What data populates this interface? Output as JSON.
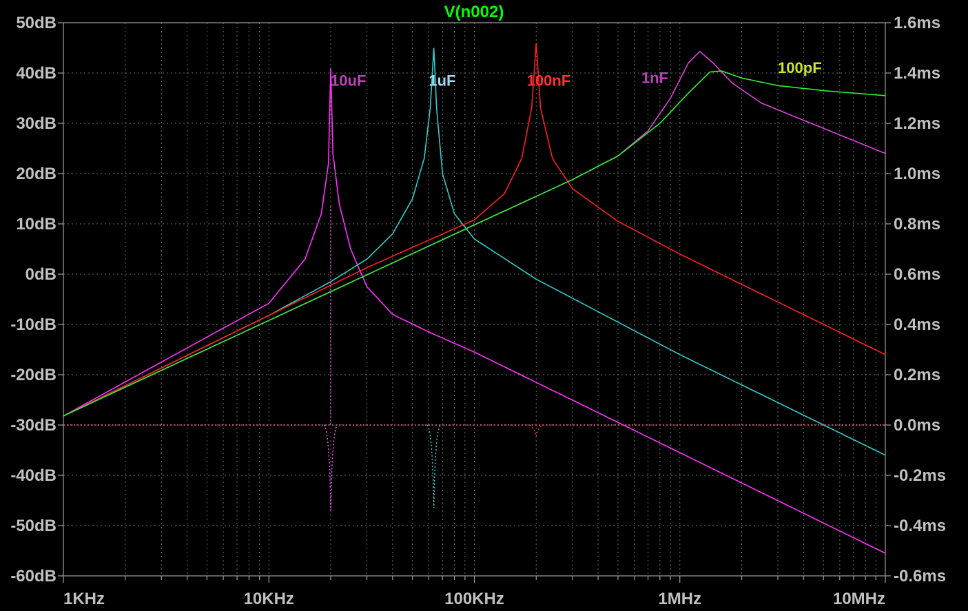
{
  "chart_data": {
    "type": "line",
    "title": "V(n002)",
    "title_color": "#00ff00",
    "x_scale": "log",
    "xlim": [
      1000,
      10000000
    ],
    "x_ticks": [
      {
        "value": 1000,
        "label": "1KHz"
      },
      {
        "value": 10000,
        "label": "10KHz"
      },
      {
        "value": 100000,
        "label": "100KHz"
      },
      {
        "value": 1000000,
        "label": "1MHz"
      },
      {
        "value": 10000000,
        "label": "10MHz"
      }
    ],
    "ylim_left": [
      -60,
      50
    ],
    "left_ticks": [
      "50dB",
      "40dB",
      "30dB",
      "20dB",
      "10dB",
      "0dB",
      "-10dB",
      "-20dB",
      "-30dB",
      "-40dB",
      "-50dB",
      "-60dB"
    ],
    "ylim_right": [
      -0.6,
      1.6
    ],
    "right_ticks": [
      "1.6ms",
      "1.4ms",
      "1.2ms",
      "1.0ms",
      "0.8ms",
      "0.6ms",
      "0.4ms",
      "0.2ms",
      "0.0ms",
      "-0.2ms",
      "-0.4ms",
      "-0.6ms"
    ],
    "grid": true,
    "series": [
      {
        "name": "10uF",
        "color": "#ff33ff",
        "label_color": "#b844b8",
        "label_at": [
          20000,
          37.5
        ],
        "points": [
          [
            1000,
            -28.2
          ],
          [
            5000,
            -12.5
          ],
          [
            10000,
            -5.8
          ],
          [
            15000,
            3
          ],
          [
            18000,
            12
          ],
          [
            19500,
            22
          ],
          [
            20000,
            41
          ],
          [
            20500,
            24
          ],
          [
            22000,
            14
          ],
          [
            25000,
            5
          ],
          [
            30000,
            -2.5
          ],
          [
            40000,
            -8
          ],
          [
            60000,
            -11.5
          ],
          [
            100000,
            -15.5
          ],
          [
            1000000,
            -35.5
          ],
          [
            10000000,
            -55.5
          ]
        ]
      },
      {
        "name": "1uF",
        "color": "#33cccc",
        "label_color": "#a0d8ee",
        "label_at": [
          60000,
          37.5
        ],
        "points": [
          [
            1000,
            -28.2
          ],
          [
            10000,
            -8.2
          ],
          [
            20000,
            -1.5
          ],
          [
            30000,
            3
          ],
          [
            40000,
            8
          ],
          [
            50000,
            15
          ],
          [
            57000,
            23
          ],
          [
            61000,
            33
          ],
          [
            63500,
            45
          ],
          [
            65500,
            33
          ],
          [
            70000,
            20
          ],
          [
            80000,
            12
          ],
          [
            100000,
            7
          ],
          [
            200000,
            -1
          ],
          [
            1000000,
            -16
          ],
          [
            10000000,
            -36
          ]
        ]
      },
      {
        "name": "100nF",
        "color": "#ff2020",
        "label_color": "#ff3030",
        "label_at": [
          180000,
          37.5
        ],
        "points": [
          [
            1000,
            -28.2
          ],
          [
            10000,
            -8.2
          ],
          [
            30000,
            1.3
          ],
          [
            100000,
            10.8
          ],
          [
            140000,
            16
          ],
          [
            170000,
            23
          ],
          [
            190000,
            33
          ],
          [
            200000,
            46
          ],
          [
            210000,
            33
          ],
          [
            240000,
            23
          ],
          [
            300000,
            17
          ],
          [
            500000,
            10.5
          ],
          [
            1000000,
            4
          ],
          [
            10000000,
            -16
          ]
        ]
      },
      {
        "name": "1nF",
        "color": "#e040e0",
        "label_color": "#b844b8",
        "label_at": [
          650000,
          38
        ],
        "points": [
          [
            1000,
            -28.2
          ],
          [
            100000,
            9.8
          ],
          [
            300000,
            18.8
          ],
          [
            500000,
            23.5
          ],
          [
            700000,
            28.5
          ],
          [
            900000,
            35
          ],
          [
            1100000,
            42
          ],
          [
            1250000,
            44.3
          ],
          [
            1450000,
            42
          ],
          [
            1800000,
            38
          ],
          [
            2500000,
            34
          ],
          [
            5000000,
            29
          ],
          [
            10000000,
            24
          ]
        ]
      },
      {
        "name": "100pF",
        "color": "#33ee33",
        "label_color": "#c8e624",
        "label_at": [
          3000000,
          40
        ],
        "points": [
          [
            1000,
            -28.2
          ],
          [
            100000,
            9.8
          ],
          [
            300000,
            18.8
          ],
          [
            500000,
            23.5
          ],
          [
            800000,
            30
          ],
          [
            1100000,
            36
          ],
          [
            1400000,
            40.2
          ],
          [
            1600000,
            40.4
          ],
          [
            2000000,
            39
          ],
          [
            3000000,
            37.5
          ],
          [
            5000000,
            36.5
          ],
          [
            10000000,
            35.5
          ]
        ]
      }
    ],
    "dotted_series": [
      {
        "color": "#ff55ff",
        "baseline": 0,
        "center": 20000,
        "spike_to": -0.34,
        "bump_to": 0.87
      },
      {
        "color": "#33cccc",
        "baseline": 0,
        "center": 63500,
        "spike_to": -0.33
      },
      {
        "color": "#ff3030",
        "baseline": 0,
        "center": 200000,
        "spike_to": -0.045
      }
    ]
  }
}
